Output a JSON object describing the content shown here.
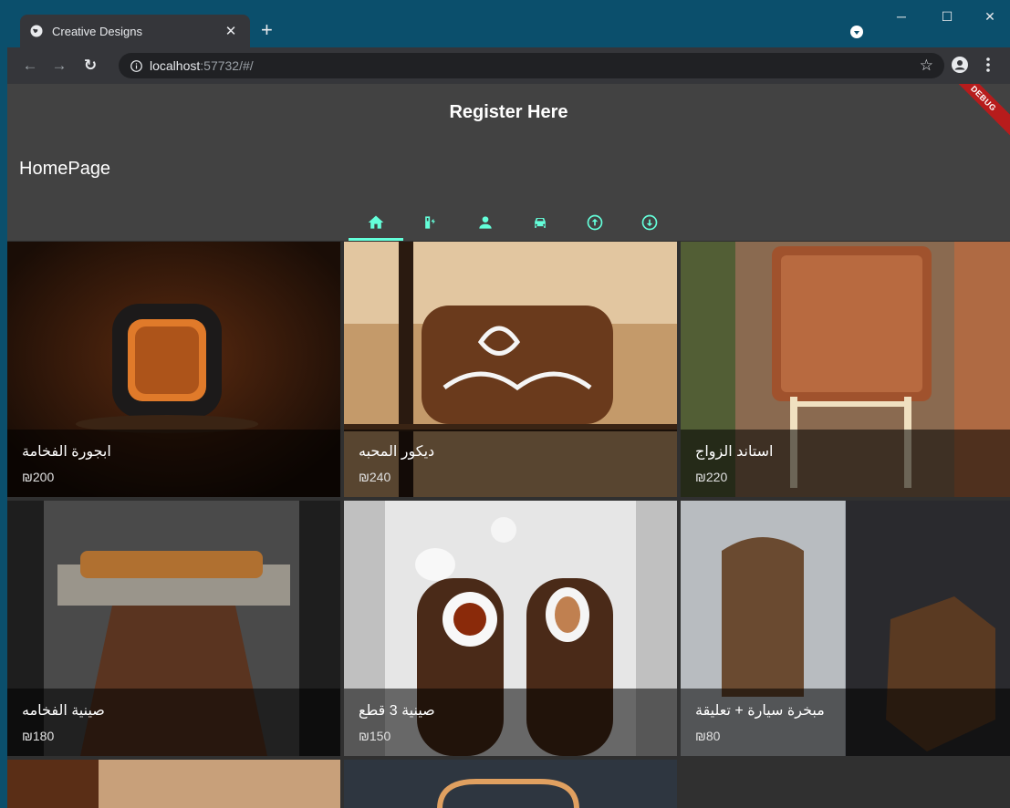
{
  "browser": {
    "tab_title": "Creative Designs",
    "tab_close": "✕",
    "new_tab": "+",
    "url_host": "localhost",
    "url_rest": ":57732/#/",
    "window_controls": [
      "─",
      "☐",
      "✕"
    ]
  },
  "app": {
    "register_label": "Register Here",
    "debug_label": "DEBUG",
    "home_title": "HomePage",
    "accent": "#64ffda",
    "tabs": [
      {
        "icon": "home-icon",
        "active": true
      },
      {
        "icon": "ev-station-icon",
        "active": false
      },
      {
        "icon": "person-icon",
        "active": false
      },
      {
        "icon": "car-icon",
        "active": false
      },
      {
        "icon": "arrow-up-circle-icon",
        "active": false
      },
      {
        "icon": "arrow-down-circle-icon",
        "active": false
      }
    ]
  },
  "products": [
    {
      "name": "ابجورة الفخامة",
      "price": "₪200"
    },
    {
      "name": "ديكور المحبه",
      "price": "₪240"
    },
    {
      "name": "استاند الزواج",
      "price": "₪220"
    },
    {
      "name": "صينية الفخامه",
      "price": "₪180"
    },
    {
      "name": "صينية 3 قطع",
      "price": "₪150"
    },
    {
      "name": "مبخرة سيارة + تعليقة",
      "price": "₪80"
    }
  ]
}
